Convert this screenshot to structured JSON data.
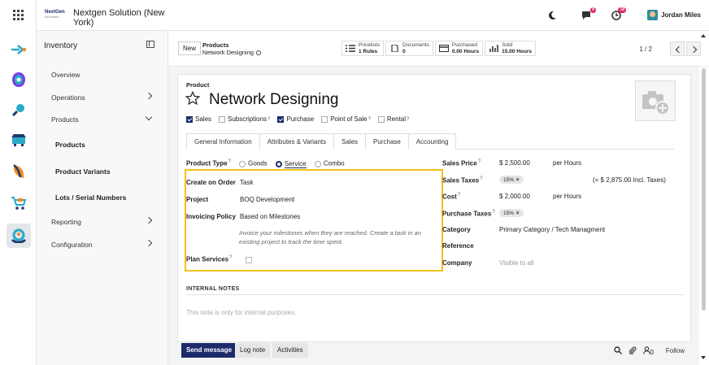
{
  "header": {
    "logo_text": "NextGen",
    "logo_sub": "SOLUTIONS",
    "company": "Nextgen Solution (New York)",
    "messages_count": "8",
    "activities_count": "18",
    "user": "Jordan Miles"
  },
  "sidebar": {
    "title": "Inventory",
    "items": [
      {
        "label": "Overview"
      },
      {
        "label": "Operations"
      },
      {
        "label": "Products"
      },
      {
        "label": "Products"
      },
      {
        "label": "Product Variants"
      },
      {
        "label": "Lots / Serial Numbers"
      },
      {
        "label": "Reporting"
      },
      {
        "label": "Configuration"
      }
    ]
  },
  "control": {
    "new_label": "New",
    "breadcrumb_parent": "Products",
    "breadcrumb_current": "Network Designing",
    "stats": [
      {
        "label": "Pricelists",
        "value": "1 Rules"
      },
      {
        "label": "Documents",
        "value": "0"
      },
      {
        "label": "Purchased",
        "value": "0.00 Hours"
      },
      {
        "label": "Sold",
        "value": "15.00 Hours"
      }
    ],
    "pager": "1 / 2"
  },
  "product": {
    "label": "Product",
    "name": "Network Designing",
    "checks": [
      {
        "label": "Sales",
        "checked": true,
        "help": false
      },
      {
        "label": "Subscriptions",
        "checked": false,
        "help": true
      },
      {
        "label": "Purchase",
        "checked": true,
        "help": false
      },
      {
        "label": "Point of Sale",
        "checked": false,
        "help": true
      },
      {
        "label": "Rental",
        "checked": false,
        "help": true
      }
    ],
    "help_mark": "?"
  },
  "tabs": [
    "General Information",
    "Attributes & Variants",
    "Sales",
    "Purchase",
    "Accounting"
  ],
  "left_fields": {
    "product_type_label": "Product Type",
    "type_options": [
      "Goods",
      "Service",
      "Combo"
    ],
    "type_selected": "Service",
    "create_on_order_label": "Create on Order",
    "create_on_order_value": "Task",
    "project_label": "Project",
    "project_value": "BOQ Development",
    "invoicing_policy_label": "Invoicing Policy",
    "invoicing_policy_value": "Based on Milestones",
    "invoicing_hint": "Invoice your milestones when they are reached. Create a task in an existing project to track the time spent.",
    "plan_services_label": "Plan Services"
  },
  "right_fields": {
    "sales_price_label": "Sales Price",
    "sales_price_value": "$ 2,500.00",
    "sales_price_unit": "per Hours",
    "sales_taxes_label": "Sales Taxes",
    "sales_taxes_tag": "15%",
    "sales_taxes_note": "(= $ 2,875.00 Incl. Taxes)",
    "cost_label": "Cost",
    "cost_value": "$ 2,000.00",
    "cost_unit": "per Hours",
    "purchase_taxes_label": "Purchase Taxes",
    "purchase_taxes_tag": "15%",
    "category_label": "Category",
    "category_value": "Primary Category / Tech Managment",
    "reference_label": "Reference",
    "company_label": "Company",
    "company_placeholder": "Visible to all"
  },
  "notes": {
    "heading": "INTERNAL NOTES",
    "placeholder": "This note is only for internal purposes."
  },
  "chatter": {
    "send": "Send message",
    "log": "Log note",
    "activities": "Activities",
    "followers_count": "0",
    "follow": "Follow"
  },
  "colors": {
    "brand": "#1e2a6a",
    "highlight": "#f3c21b"
  }
}
